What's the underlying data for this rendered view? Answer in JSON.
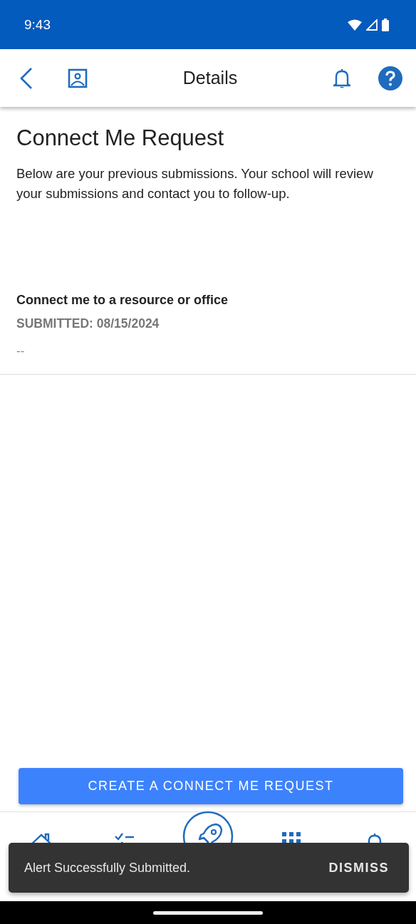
{
  "status_bar": {
    "time": "9:43"
  },
  "app_bar": {
    "title": "Details"
  },
  "page": {
    "title": "Connect Me Request",
    "description": "Below are your previous submissions. Your school will review your submissions and contact you to follow-up."
  },
  "submissions": [
    {
      "title": "Connect me to a resource or office",
      "submitted": "SUBMITTED: 08/15/2024",
      "detail": "--"
    }
  ],
  "create_button": "CREATE A CONNECT ME REQUEST",
  "bottom_nav": [
    {
      "kind": "home"
    },
    {
      "kind": "tasks"
    },
    {
      "kind": "rocket"
    },
    {
      "kind": "grid"
    },
    {
      "kind": "bell"
    }
  ],
  "snackbar": {
    "message": "Alert Successfully Submitted.",
    "action": "DISMISS"
  }
}
